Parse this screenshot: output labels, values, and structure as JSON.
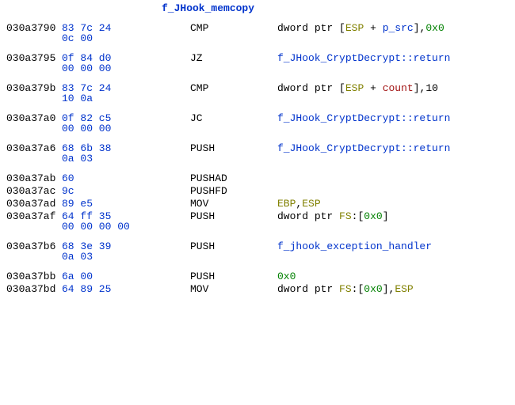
{
  "function_label": "f_JHook_memcopy",
  "rows": [
    {
      "addr": "030a3790",
      "bytes": [
        "83 7c 24",
        "0c 00"
      ],
      "mnemonic": "CMP",
      "operand_html": "<span class='c-kw'>dword</span> <span class='c-kw'>ptr </span><span class='c-punct'>[</span><span class='c-reg'>ESP</span> <span class='c-punct'>+</span> <span class='c-var'>p_src</span><span class='c-punct'>]</span><span class='c-punct'>,</span><span class='c-num'>0x0</span>"
    },
    {
      "addr": "030a3795",
      "bytes": [
        "0f 84 d0",
        "00 00 00"
      ],
      "mnemonic": "JZ",
      "operand_html": "<span class='c-sym'>f_JHook_CryptDecrypt::return</span>"
    },
    {
      "addr": "030a379b",
      "bytes": [
        "83 7c 24",
        "10 0a"
      ],
      "mnemonic": "CMP",
      "operand_html": "<span class='c-kw'>dword</span> <span class='c-kw'>ptr </span><span class='c-punct'>[</span><span class='c-reg'>ESP</span> <span class='c-punct'>+</span> <span class='c-cnt'>count</span><span class='c-punct'>]</span><span class='c-punct'>,</span><span class='c-kw'>10</span>"
    },
    {
      "addr": "030a37a0",
      "bytes": [
        "0f 82 c5",
        "00 00 00"
      ],
      "mnemonic": "JC",
      "operand_html": "<span class='c-sym'>f_JHook_CryptDecrypt::return</span>"
    },
    {
      "addr": "030a37a6",
      "bytes": [
        "68 6b 38",
        "0a 03"
      ],
      "mnemonic": "PUSH",
      "operand_html": "<span class='c-sym'>f_JHook_CryptDecrypt::return</span>"
    },
    {
      "addr": "030a37ab",
      "bytes": [
        "60"
      ],
      "mnemonic": "PUSHAD",
      "operand_html": ""
    },
    {
      "addr": "030a37ac",
      "bytes": [
        "9c"
      ],
      "mnemonic": "PUSHFD",
      "operand_html": ""
    },
    {
      "addr": "030a37ad",
      "bytes": [
        "89 e5"
      ],
      "mnemonic": "MOV",
      "operand_html": "<span class='c-reg'>EBP</span><span class='c-punct'>,</span><span class='c-reg'>ESP</span>"
    },
    {
      "addr": "030a37af",
      "bytes": [
        "64 ff 35",
        "00 00 00 00"
      ],
      "mnemonic": "PUSH",
      "operand_html": "<span class='c-kw'>dword</span> <span class='c-kw'>ptr </span><span class='c-reg'>FS</span><span class='c-punct'>:</span><span class='c-punct'>[</span><span class='c-num'>0x0</span><span class='c-punct'>]</span>"
    },
    {
      "addr": "030a37b6",
      "bytes": [
        "68 3e 39",
        "0a 03"
      ],
      "mnemonic": "PUSH",
      "operand_html": "<span class='c-sym'>f_jhook_exception_handler</span>"
    },
    {
      "addr": "030a37bb",
      "bytes": [
        "6a 00"
      ],
      "mnemonic": "PUSH",
      "operand_html": "<span class='c-num'>0x0</span>"
    },
    {
      "addr": "030a37bd",
      "bytes": [
        "64 89 25"
      ],
      "mnemonic": "MOV",
      "operand_html": "<span class='c-kw'>dword</span> <span class='c-kw'>ptr </span><span class='c-reg'>FS</span><span class='c-punct'>:</span><span class='c-punct'>[</span><span class='c-num'>0x0</span><span class='c-punct'>]</span><span class='c-punct'>,</span><span class='c-reg'>ESP</span>"
    }
  ]
}
